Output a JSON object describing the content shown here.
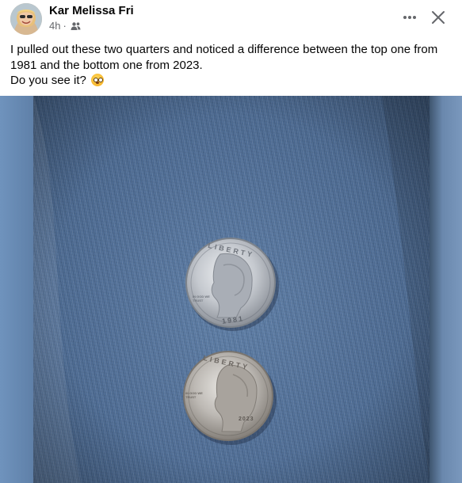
{
  "post": {
    "author": "Kar Melissa Fri",
    "time": "4h",
    "separator": "·",
    "audience_icon": "friends-icon",
    "caption_line1": "I pulled out these two quarters and noticed a difference between the top one from 1981 and the bottom one from 2023.",
    "caption_line2": "Do you see it?",
    "emoji": "flushed-face-emoji"
  },
  "photo": {
    "top_coin": {
      "legend": "LIBERTY",
      "motto": "IN GOD WE TRUST",
      "year": "1981"
    },
    "bottom_coin": {
      "legend": "LIBERTY",
      "motto": "IN GOD WE TRUST",
      "year": "2023"
    }
  },
  "colors": {
    "author_text": "#050505",
    "meta_text": "#65676b",
    "denim": "#4e6c94",
    "photo_backdrop": "#6b8cb1"
  }
}
